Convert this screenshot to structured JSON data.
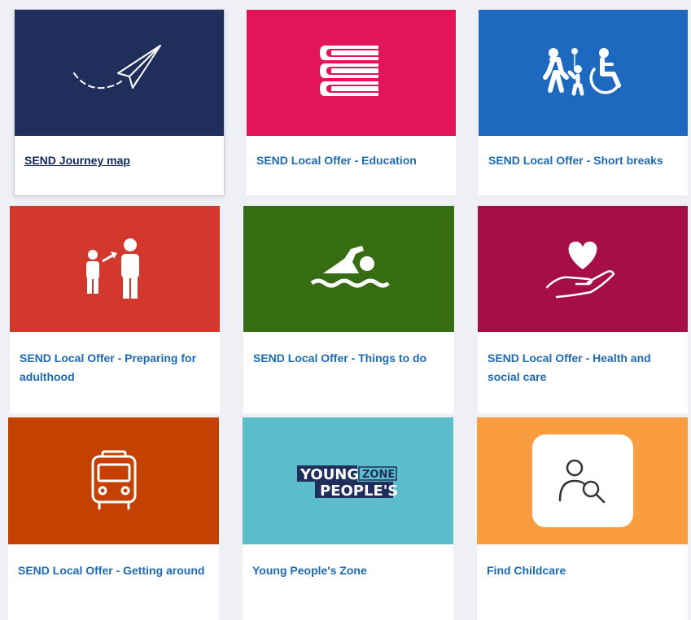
{
  "cards": [
    {
      "label": "SEND Journey map",
      "icon": "paper-plane-icon",
      "color": "#1f2e5a"
    },
    {
      "label": "SEND Local Offer - Education",
      "icon": "books-icon",
      "color": "#e31458"
    },
    {
      "label": "SEND Local Offer - Short breaks",
      "icon": "family-wheelchair-icon",
      "color": "#1d69bf"
    },
    {
      "label": "SEND Local Offer - Preparing for adulthood",
      "icon": "child-to-adult-icon",
      "color": "#d2392c"
    },
    {
      "label": "SEND Local Offer - Things to do",
      "icon": "swimmer-icon",
      "color": "#366d12"
    },
    {
      "label": "SEND Local Offer - Health and social care",
      "icon": "heart-in-hand-icon",
      "color": "#a50f46"
    },
    {
      "label": "SEND Local Offer - Getting around",
      "icon": "bus-icon",
      "color": "#c54102"
    },
    {
      "label": "Young People's Zone",
      "icon": "young-peoples-zone-logo",
      "color": "#5bbdca"
    },
    {
      "label": "Find Childcare",
      "icon": "person-search-icon",
      "color": "#f99d40"
    }
  ],
  "logo": {
    "line1": "YOUNG",
    "line2": "PEOPLE'S",
    "badge": "ZONE"
  },
  "colors": {
    "link": "#1d6ab5",
    "focused_link": "#102a5c",
    "background": "#eef0f6"
  }
}
